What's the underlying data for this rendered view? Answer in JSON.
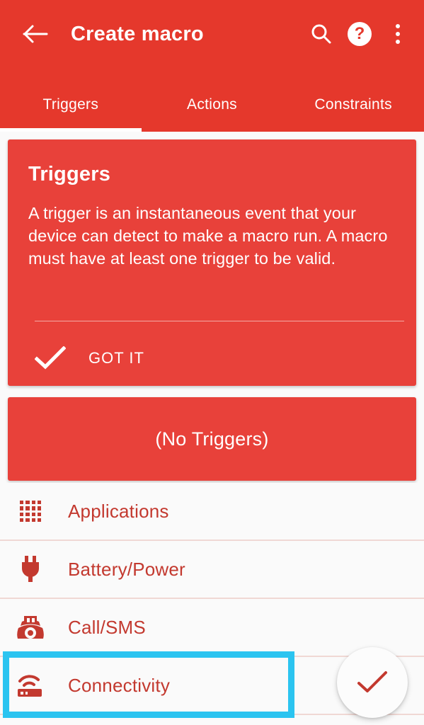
{
  "appbar": {
    "title": "Create macro",
    "back_icon": "arrow-back-icon",
    "search_icon": "search-icon",
    "help_label": "?",
    "help_icon": "help-circle-icon",
    "overflow_icon": "more-vertical-icon",
    "background_color": "#E5382C"
  },
  "tabs": [
    {
      "label": "Triggers",
      "selected": true
    },
    {
      "label": "Actions",
      "selected": false
    },
    {
      "label": "Constraints",
      "selected": false
    }
  ],
  "info_card": {
    "title": "Triggers",
    "body": "A trigger is an instantaneous event that your device can detect to make a macro run. A macro must have at least one trigger to be valid.",
    "dismiss_label": "GOT IT",
    "dismiss_icon": "check-icon",
    "background_color": "#E8413A"
  },
  "no_triggers_button": {
    "label": "(No Triggers)",
    "background_color": "#E8413A"
  },
  "list": {
    "items": [
      {
        "label": "Applications",
        "icon": "apps-grid-icon",
        "highlighted": false
      },
      {
        "label": "Battery/Power",
        "icon": "power-plug-icon",
        "highlighted": false
      },
      {
        "label": "Call/SMS",
        "icon": "telephone-icon",
        "highlighted": false
      },
      {
        "label": "Connectivity",
        "icon": "router-wifi-icon",
        "highlighted": true
      }
    ],
    "text_color": "#C3392F",
    "divider_color": "#F0D8D4"
  },
  "highlight": {
    "target": "Connectivity",
    "color": "#2BC4F0"
  },
  "fab": {
    "icon": "check-icon",
    "color": "#C3392F",
    "background_color": "#FCFCFC"
  }
}
